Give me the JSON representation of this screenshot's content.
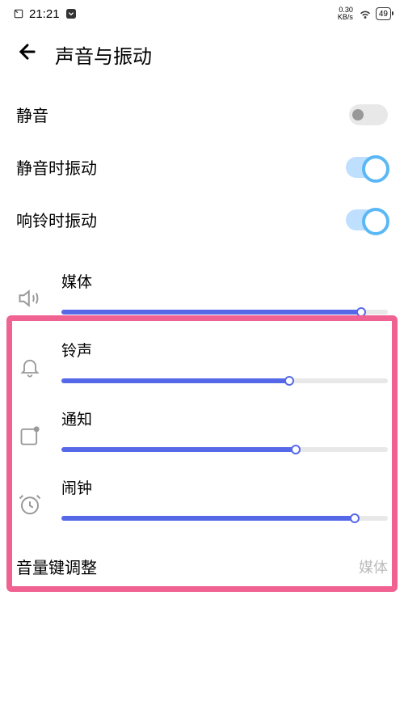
{
  "status": {
    "time": "21:21",
    "net_speed_top": "0.30",
    "net_speed_bottom": "KB/s",
    "battery": "49"
  },
  "header": {
    "title": "声音与振动"
  },
  "toggles": {
    "mute": {
      "label": "静音",
      "on": false
    },
    "vibrate_on_mute": {
      "label": "静音时振动",
      "on": true
    },
    "vibrate_on_ring": {
      "label": "响铃时振动",
      "on": true
    }
  },
  "volumes": {
    "media": {
      "label": "媒体",
      "percent": 92
    },
    "ringtone": {
      "label": "铃声",
      "percent": 70
    },
    "notification": {
      "label": "通知",
      "percent": 72
    },
    "alarm": {
      "label": "闹钟",
      "percent": 90
    }
  },
  "volume_key": {
    "label": "音量键调整",
    "value": "媒体"
  }
}
